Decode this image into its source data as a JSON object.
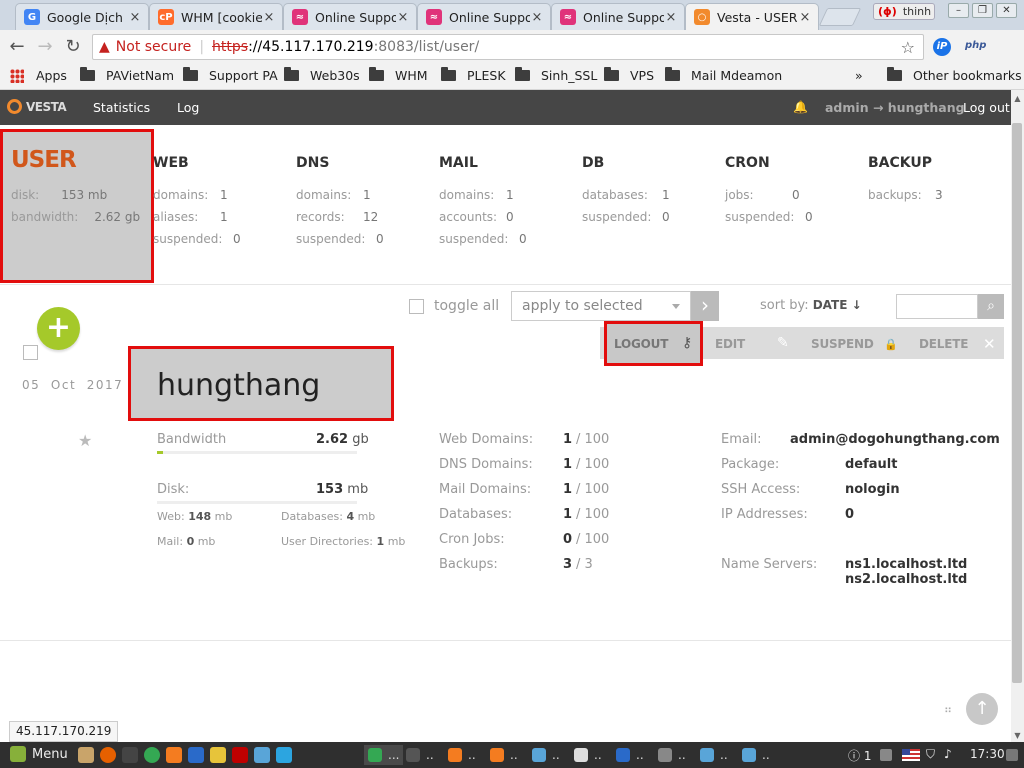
{
  "browser": {
    "tabs": [
      {
        "title": "Google Dịch",
        "favicon": "google-translate-icon",
        "color": "#4285f4",
        "glyph": "G"
      },
      {
        "title": "WHM [cookie",
        "favicon": "cpanel-icon",
        "color": "#ff6c2c",
        "glyph": "cP"
      },
      {
        "title": "Online Suppo",
        "favicon": "support-icon",
        "color": "#e0337a",
        "glyph": "≈"
      },
      {
        "title": "Online Suppo",
        "favicon": "support-icon",
        "color": "#e0337a",
        "glyph": "≈"
      },
      {
        "title": "Online Suppo",
        "favicon": "support-icon",
        "color": "#e0337a",
        "glyph": "≈"
      },
      {
        "title": "Vesta - USER",
        "favicon": "vesta-icon",
        "color": "#f28a2d",
        "glyph": "○"
      }
    ],
    "tab_close_glyph": "×",
    "profile_name": "thinh",
    "profile_glyph": "(ɸ)",
    "window_controls": [
      "–",
      "❐",
      "✕"
    ],
    "address": {
      "warning_glyph": "▲",
      "not_secure": "Not secure",
      "separator": "|",
      "scheme": "https",
      "host": "://45.117.170.219",
      "path": ":8083/list/user/"
    },
    "nav_glyphs": {
      "back": "←",
      "forward": "→",
      "reload": "↻",
      "bookmark": "☆"
    },
    "extensions": [
      {
        "label": "iP",
        "color": "#fff",
        "bg": "#1a73e8"
      },
      {
        "label": "php",
        "color": "#3b5998",
        "bg": "transparent"
      }
    ],
    "bookmarks": [
      "Apps",
      "PAVietNam",
      "Support PA",
      "Web30s",
      "WHM",
      "PLESK",
      "Sinh_SSL",
      "VPS",
      "Mail Mdeamon"
    ],
    "bookmarks_overflow": "»",
    "other_bookmarks": "Other bookmarks",
    "status_url": "45.117.170.219"
  },
  "vesta": {
    "logo_text": "VESTA",
    "nav": {
      "statistics": "Statistics",
      "log": "Log"
    },
    "bell_glyph": "🔔",
    "user_switch": "admin → hungthang",
    "logout": "Log out",
    "summary": {
      "title": "USER",
      "disk_label": "disk:",
      "disk_value": "153 mb",
      "bandwidth_label": "bandwidth:",
      "bandwidth_value": "2.62 gb",
      "sections": [
        {
          "title": "WEB",
          "rows": [
            [
              "domains:",
              "1"
            ],
            [
              "aliases:",
              "1"
            ],
            [
              "suspended:",
              "0"
            ]
          ]
        },
        {
          "title": "DNS",
          "rows": [
            [
              "domains:",
              "1"
            ],
            [
              "records:",
              "12"
            ],
            [
              "suspended:",
              "0"
            ]
          ]
        },
        {
          "title": "MAIL",
          "rows": [
            [
              "domains:",
              "1"
            ],
            [
              "accounts:",
              "0"
            ],
            [
              "suspended:",
              "0"
            ]
          ]
        },
        {
          "title": "DB",
          "rows": [
            [
              "databases:",
              "1"
            ],
            [
              "suspended:",
              "0"
            ]
          ]
        },
        {
          "title": "CRON",
          "rows": [
            [
              "jobs:",
              "0"
            ],
            [
              "suspended:",
              "0"
            ]
          ]
        },
        {
          "title": "BACKUP",
          "rows": [
            [
              "backups:",
              "3"
            ]
          ]
        }
      ]
    },
    "toolbar": {
      "toggle_all": "toggle all",
      "apply_placeholder": "apply to selected",
      "apply_glyph": "›",
      "sort_label": "sort by:",
      "sort_value": "DATE ↓",
      "search_glyph": "⌕",
      "add_glyph": "+"
    },
    "actions": [
      {
        "label": "LOGOUT",
        "icon": "keyhole-icon",
        "glyph": "⚷"
      },
      {
        "label": "EDIT",
        "icon": "pencil-icon",
        "glyph": "✎"
      },
      {
        "label": "SUSPEND",
        "icon": "lock-icon",
        "glyph": "🔒"
      },
      {
        "label": "DELETE",
        "icon": "close-icon",
        "glyph": "✕"
      }
    ],
    "user": {
      "date": "05  Oct  2017",
      "star_glyph": "★",
      "name": "hungthang",
      "bandwidth_label": "Bandwidth",
      "bandwidth_value": "2.62",
      "bandwidth_unit": "gb",
      "bandwidth_usage_fraction": 0.03,
      "disk_label": "Disk:",
      "disk_value": "153",
      "disk_unit": "mb",
      "disk_usage_fraction": 0.0,
      "web_label": "Web:",
      "web_value": "148",
      "web_unit": "mb",
      "databases_label": "Databases:",
      "databases_value": "4",
      "databases_unit": "mb",
      "mail_label": "Mail:",
      "mail_value": "0",
      "mail_unit": "mb",
      "userdirs_label": "User Directories:",
      "userdirs_value": "1",
      "userdirs_unit": "mb",
      "limits": [
        {
          "label": "Web Domains:",
          "used": "1",
          "limit": "100"
        },
        {
          "label": "DNS Domains:",
          "used": "1",
          "limit": "100"
        },
        {
          "label": "Mail Domains:",
          "used": "1",
          "limit": "100"
        },
        {
          "label": "Databases:",
          "used": "1",
          "limit": "100"
        },
        {
          "label": "Cron Jobs:",
          "used": "0",
          "limit": "100"
        },
        {
          "label": "Backups:",
          "used": "3",
          "limit": "3"
        }
      ],
      "limit_separator": "/",
      "email_label": "Email:",
      "email_value": "admin@dogohungthang.com",
      "package_label": "Package:",
      "package_value": "default",
      "ssh_label": "SSH Access:",
      "ssh_value": "nologin",
      "ip_label": "IP Addresses:",
      "ip_value": "0",
      "ns_label": "Name Servers:",
      "ns1": "ns1.localhost.ltd",
      "ns2": "ns2.localhost.ltd"
    },
    "scroll_top_glyph": "↑",
    "dots_glyph": "⠶"
  },
  "taskbar": {
    "menu_label": "Menu",
    "launchers": [
      {
        "name": "files-launcher-icon",
        "color": "#c9a46a"
      },
      {
        "name": "firefox-launcher-icon",
        "color": "#e66000"
      },
      {
        "name": "terminal-launcher-icon",
        "color": "#444"
      },
      {
        "name": "chrome-launcher-icon",
        "color": "#34a853"
      },
      {
        "name": "burp-launcher-icon",
        "color": "#f47c20"
      },
      {
        "name": "thunderbird-launcher-icon",
        "color": "#2a6ac9"
      },
      {
        "name": "notes-launcher-icon",
        "color": "#e7c43a"
      },
      {
        "name": "filezilla-launcher-icon",
        "color": "#bf0000"
      },
      {
        "name": "network-launcher-icon",
        "color": "#59a5d8"
      },
      {
        "name": "telegram-launcher-icon",
        "color": "#2ca5e0"
      }
    ],
    "tasks": [
      {
        "color": "#34a853",
        "label": "...",
        "active": true
      },
      {
        "color": "#555",
        "label": "..",
        "active": false
      },
      {
        "color": "#f47c20",
        "label": "..",
        "active": false
      },
      {
        "color": "#f47c20",
        "label": "..",
        "active": false
      },
      {
        "color": "#59a5d8",
        "label": "..",
        "active": false
      },
      {
        "color": "#ddd",
        "label": "..",
        "active": false
      },
      {
        "color": "#2a6ac9",
        "label": "..",
        "active": false
      },
      {
        "color": "#888",
        "label": "..",
        "active": false
      },
      {
        "color": "#59a5d8",
        "label": "..",
        "active": false
      },
      {
        "color": "#59a5d8",
        "label": "..",
        "active": false
      }
    ],
    "tray_alert": "ⓘ 1",
    "clock": "17:30"
  },
  "colors": {
    "accent_orange": "#d1571b",
    "highlight_red": "#e20d0d",
    "add_green": "#a5c92a",
    "nav_dark": "#464646"
  }
}
